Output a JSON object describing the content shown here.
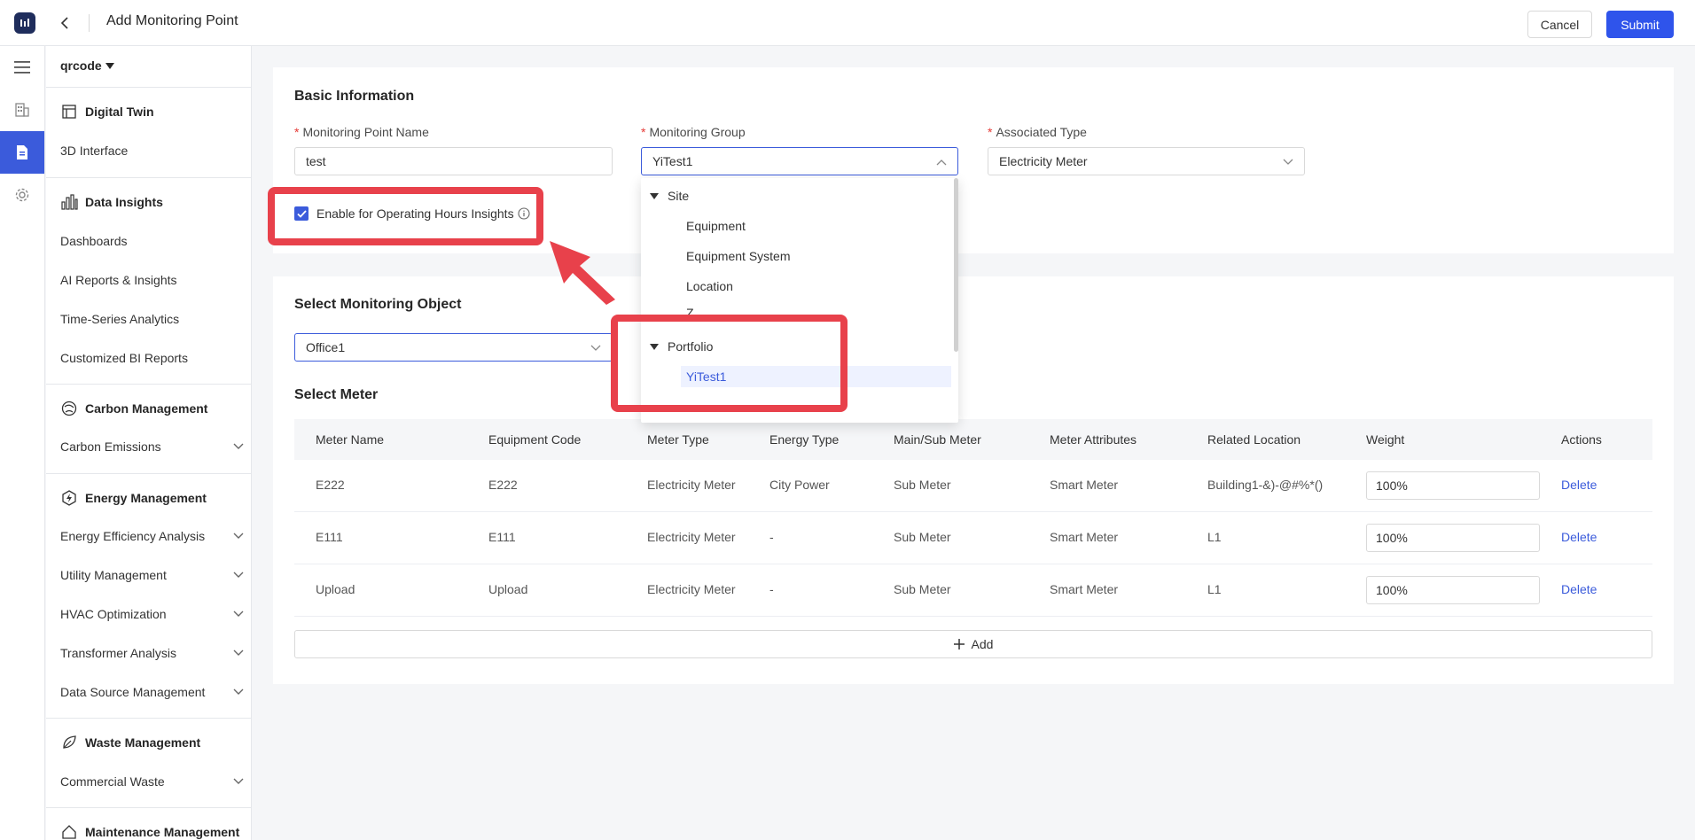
{
  "header": {
    "title": "Add Monitoring Point",
    "cancel_label": "Cancel",
    "submit_label": "Submit"
  },
  "sidebar": {
    "tenant": "qrcode",
    "groups": [
      {
        "title": "Digital Twin",
        "items": [
          {
            "label": "3D Interface"
          }
        ]
      },
      {
        "title": "Data Insights",
        "items": [
          {
            "label": "Dashboards"
          },
          {
            "label": "AI Reports & Insights"
          },
          {
            "label": "Time-Series Analytics"
          },
          {
            "label": "Customized BI Reports"
          }
        ]
      },
      {
        "title": "Carbon Management",
        "items": [
          {
            "label": "Carbon Emissions"
          }
        ]
      },
      {
        "title": "Energy Management",
        "items": [
          {
            "label": "Energy Efficiency Analysis"
          },
          {
            "label": "Utility Management"
          },
          {
            "label": "HVAC Optimization"
          },
          {
            "label": "Transformer Analysis"
          },
          {
            "label": "Data Source Management"
          }
        ]
      },
      {
        "title": "Waste Management",
        "items": [
          {
            "label": "Commercial Waste"
          }
        ]
      },
      {
        "title": "Maintenance Management",
        "items": []
      }
    ]
  },
  "basic": {
    "title": "Basic Information",
    "name_label": "Monitoring Point Name",
    "name_value": "test",
    "group_label": "Monitoring Group",
    "group_value": "YiTest1",
    "type_label": "Associated Type",
    "type_value": "Electricity Meter",
    "checkbox_label": "Enable for Operating Hours Insights"
  },
  "dropdown": {
    "rows": [
      {
        "label": "Site",
        "kind": "parent"
      },
      {
        "label": "Equipment",
        "kind": "child"
      },
      {
        "label": "Equipment System",
        "kind": "child"
      },
      {
        "label": "Location",
        "kind": "child"
      },
      {
        "label": "Z...",
        "kind": "child"
      },
      {
        "label": "Portfolio",
        "kind": "parent"
      },
      {
        "label": "YiTest1",
        "kind": "child",
        "selected": true
      },
      {
        "label": "...",
        "kind": "child"
      }
    ]
  },
  "monitoring_object": {
    "title": "Select Monitoring Object",
    "value": "Office1"
  },
  "meter": {
    "title": "Select Meter",
    "columns": [
      "Meter Name",
      "Equipment Code",
      "Meter Type",
      "Energy Type",
      "Main/Sub Meter",
      "Meter Attributes",
      "Related Location",
      "Weight",
      "Actions"
    ],
    "rows": [
      {
        "name": "E222",
        "code": "E222",
        "type": "Electricity Meter",
        "energy": "City Power",
        "mainsub": "Sub Meter",
        "attr": "Smart Meter",
        "location": "Building1-&)-@#%*()",
        "weight": "100%",
        "action": "Delete"
      },
      {
        "name": "E111",
        "code": "E111",
        "type": "Electricity Meter",
        "energy": "-",
        "mainsub": "Sub Meter",
        "attr": "Smart Meter",
        "location": "L1",
        "weight": "100%",
        "action": "Delete"
      },
      {
        "name": "Upload",
        "code": "Upload",
        "type": "Electricity Meter",
        "energy": "-",
        "mainsub": "Sub Meter",
        "attr": "Smart Meter",
        "location": "L1",
        "weight": "100%",
        "action": "Delete"
      }
    ],
    "add_label": "Add"
  },
  "colors": {
    "accent": "#2f54eb",
    "annotation": "#e8414b"
  }
}
